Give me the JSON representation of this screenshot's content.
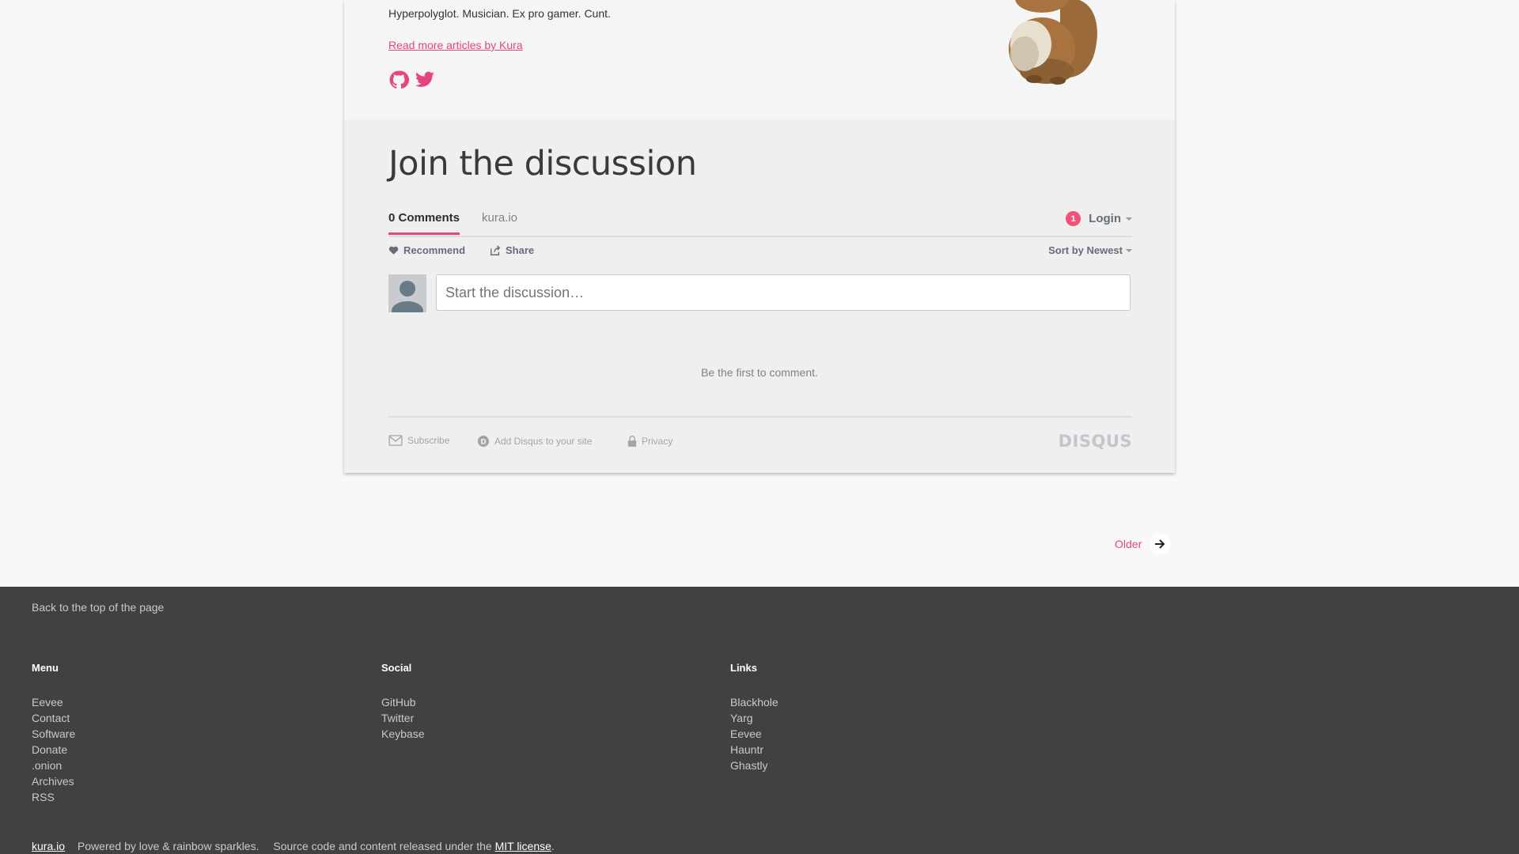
{
  "author": {
    "bio": "Hyperpolyglot. Musician. Ex pro gamer. Cunt.",
    "more_link": "Read more articles by Kura",
    "social": [
      "github-icon",
      "twitter-icon"
    ]
  },
  "discussion": {
    "title": "Join the discussion",
    "tab_comments": "0 Comments",
    "tab_forum": "kura.io",
    "login_badge": "1",
    "login_label": "Login",
    "recommend_label": "Recommend",
    "share_label": "Share",
    "sort_label": "Sort by Newest",
    "input_placeholder": "Start the discussion…",
    "empty_text": "Be the first to comment.",
    "footer": {
      "subscribe": "Subscribe",
      "add_disqus": "Add Disqus to your site",
      "privacy": "Privacy",
      "brand": "DISQUS"
    }
  },
  "pagination": {
    "older_label": "Older"
  },
  "footer": {
    "back_top": "Back to the top of the page",
    "menu": {
      "heading": "Menu",
      "items": [
        "Eevee",
        "Contact",
        "Software",
        "Donate",
        ".onion",
        "Archives",
        "RSS"
      ]
    },
    "social": {
      "heading": "Social",
      "items": [
        "GitHub",
        "Twitter",
        "Keybase"
      ]
    },
    "links": {
      "heading": "Links",
      "items": [
        "Blackhole",
        "Yarg",
        "Eevee",
        "Hauntr",
        "Ghastly"
      ]
    },
    "site_name": "kura.io",
    "powered": "Powered by love & rainbow sparkles.",
    "license_text": "Source code and content released under the",
    "license_link": "MIT license",
    "license_end": "."
  },
  "colors": {
    "accent": "#e5457f",
    "footer_bg": "#414141",
    "page_bg": "#f8f8f8"
  }
}
